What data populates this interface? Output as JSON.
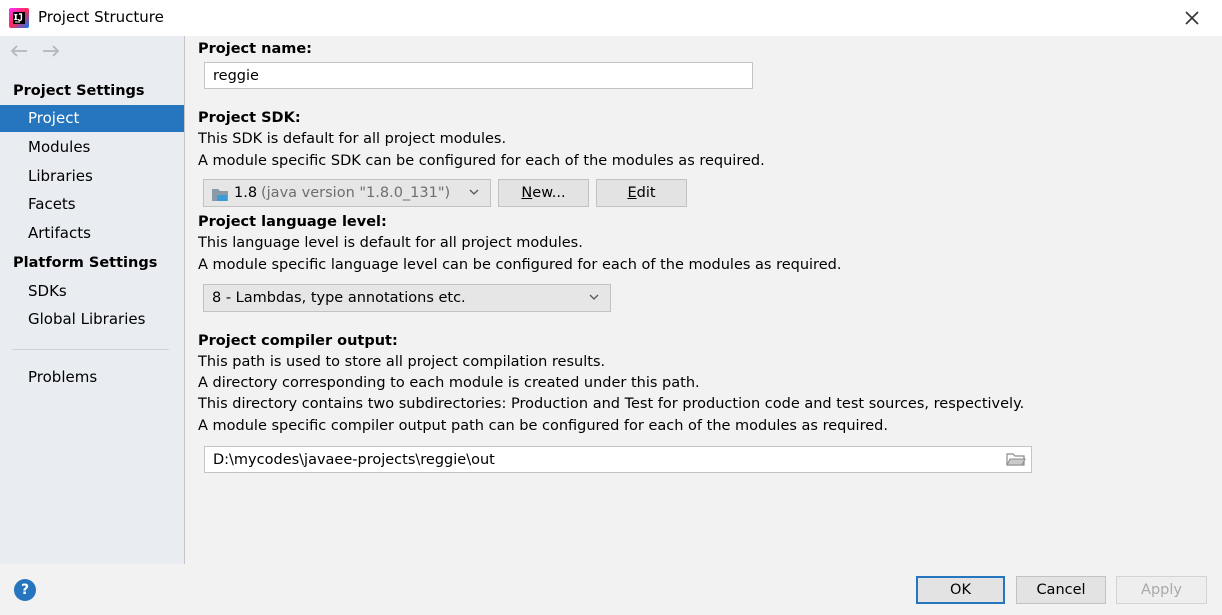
{
  "window": {
    "title": "Project Structure"
  },
  "sidebar": {
    "project_settings_header": "Project Settings",
    "project_items": [
      "Project",
      "Modules",
      "Libraries",
      "Facets",
      "Artifacts"
    ],
    "platform_settings_header": "Platform Settings",
    "platform_items": [
      "SDKs",
      "Global Libraries"
    ],
    "problems": "Problems",
    "selected": "Project"
  },
  "main": {
    "project_name_label": "Project name:",
    "project_name_value": "reggie",
    "sdk_label": "Project SDK:",
    "sdk_desc1": "This SDK is default for all project modules.",
    "sdk_desc2": "A module specific SDK can be configured for each of the modules as required.",
    "sdk_selected_version": "1.8",
    "sdk_selected_detail": "(java version \"1.8.0_131\")",
    "sdk_new_button_mnemonic": "N",
    "sdk_new_button_rest": "ew...",
    "sdk_edit_button_mnemonic": "E",
    "sdk_edit_button_rest": "dit",
    "language_label": "Project language level:",
    "language_desc1": "This language level is default for all project modules.",
    "language_desc2": "A module specific language level can be configured for each of the modules as required.",
    "language_selected": "8 - Lambdas, type annotations etc.",
    "output_label": "Project compiler output:",
    "output_desc1": "This path is used to store all project compilation results.",
    "output_desc2": "A directory corresponding to each module is created under this path.",
    "output_desc3": "This directory contains two subdirectories: Production and Test for production code and test sources, respectively.",
    "output_desc4": "A module specific compiler output path can be configured for each of the modules as required.",
    "output_path": "D:\\mycodes\\javaee-projects\\reggie\\out"
  },
  "footer": {
    "help": "?",
    "ok": "OK",
    "cancel": "Cancel",
    "apply": "Apply"
  },
  "colors": {
    "accent": "#2675bf",
    "sidebar_bg": "#e9edf1",
    "content_bg": "#f2f2f2"
  },
  "icons": {
    "app_logo": "intellij-idea-logo",
    "close": "close-icon",
    "back": "arrow-left-icon",
    "forward": "arrow-right-icon",
    "sdk": "folder-sdk-icon",
    "folder": "folder-open-icon",
    "help": "help-icon"
  }
}
